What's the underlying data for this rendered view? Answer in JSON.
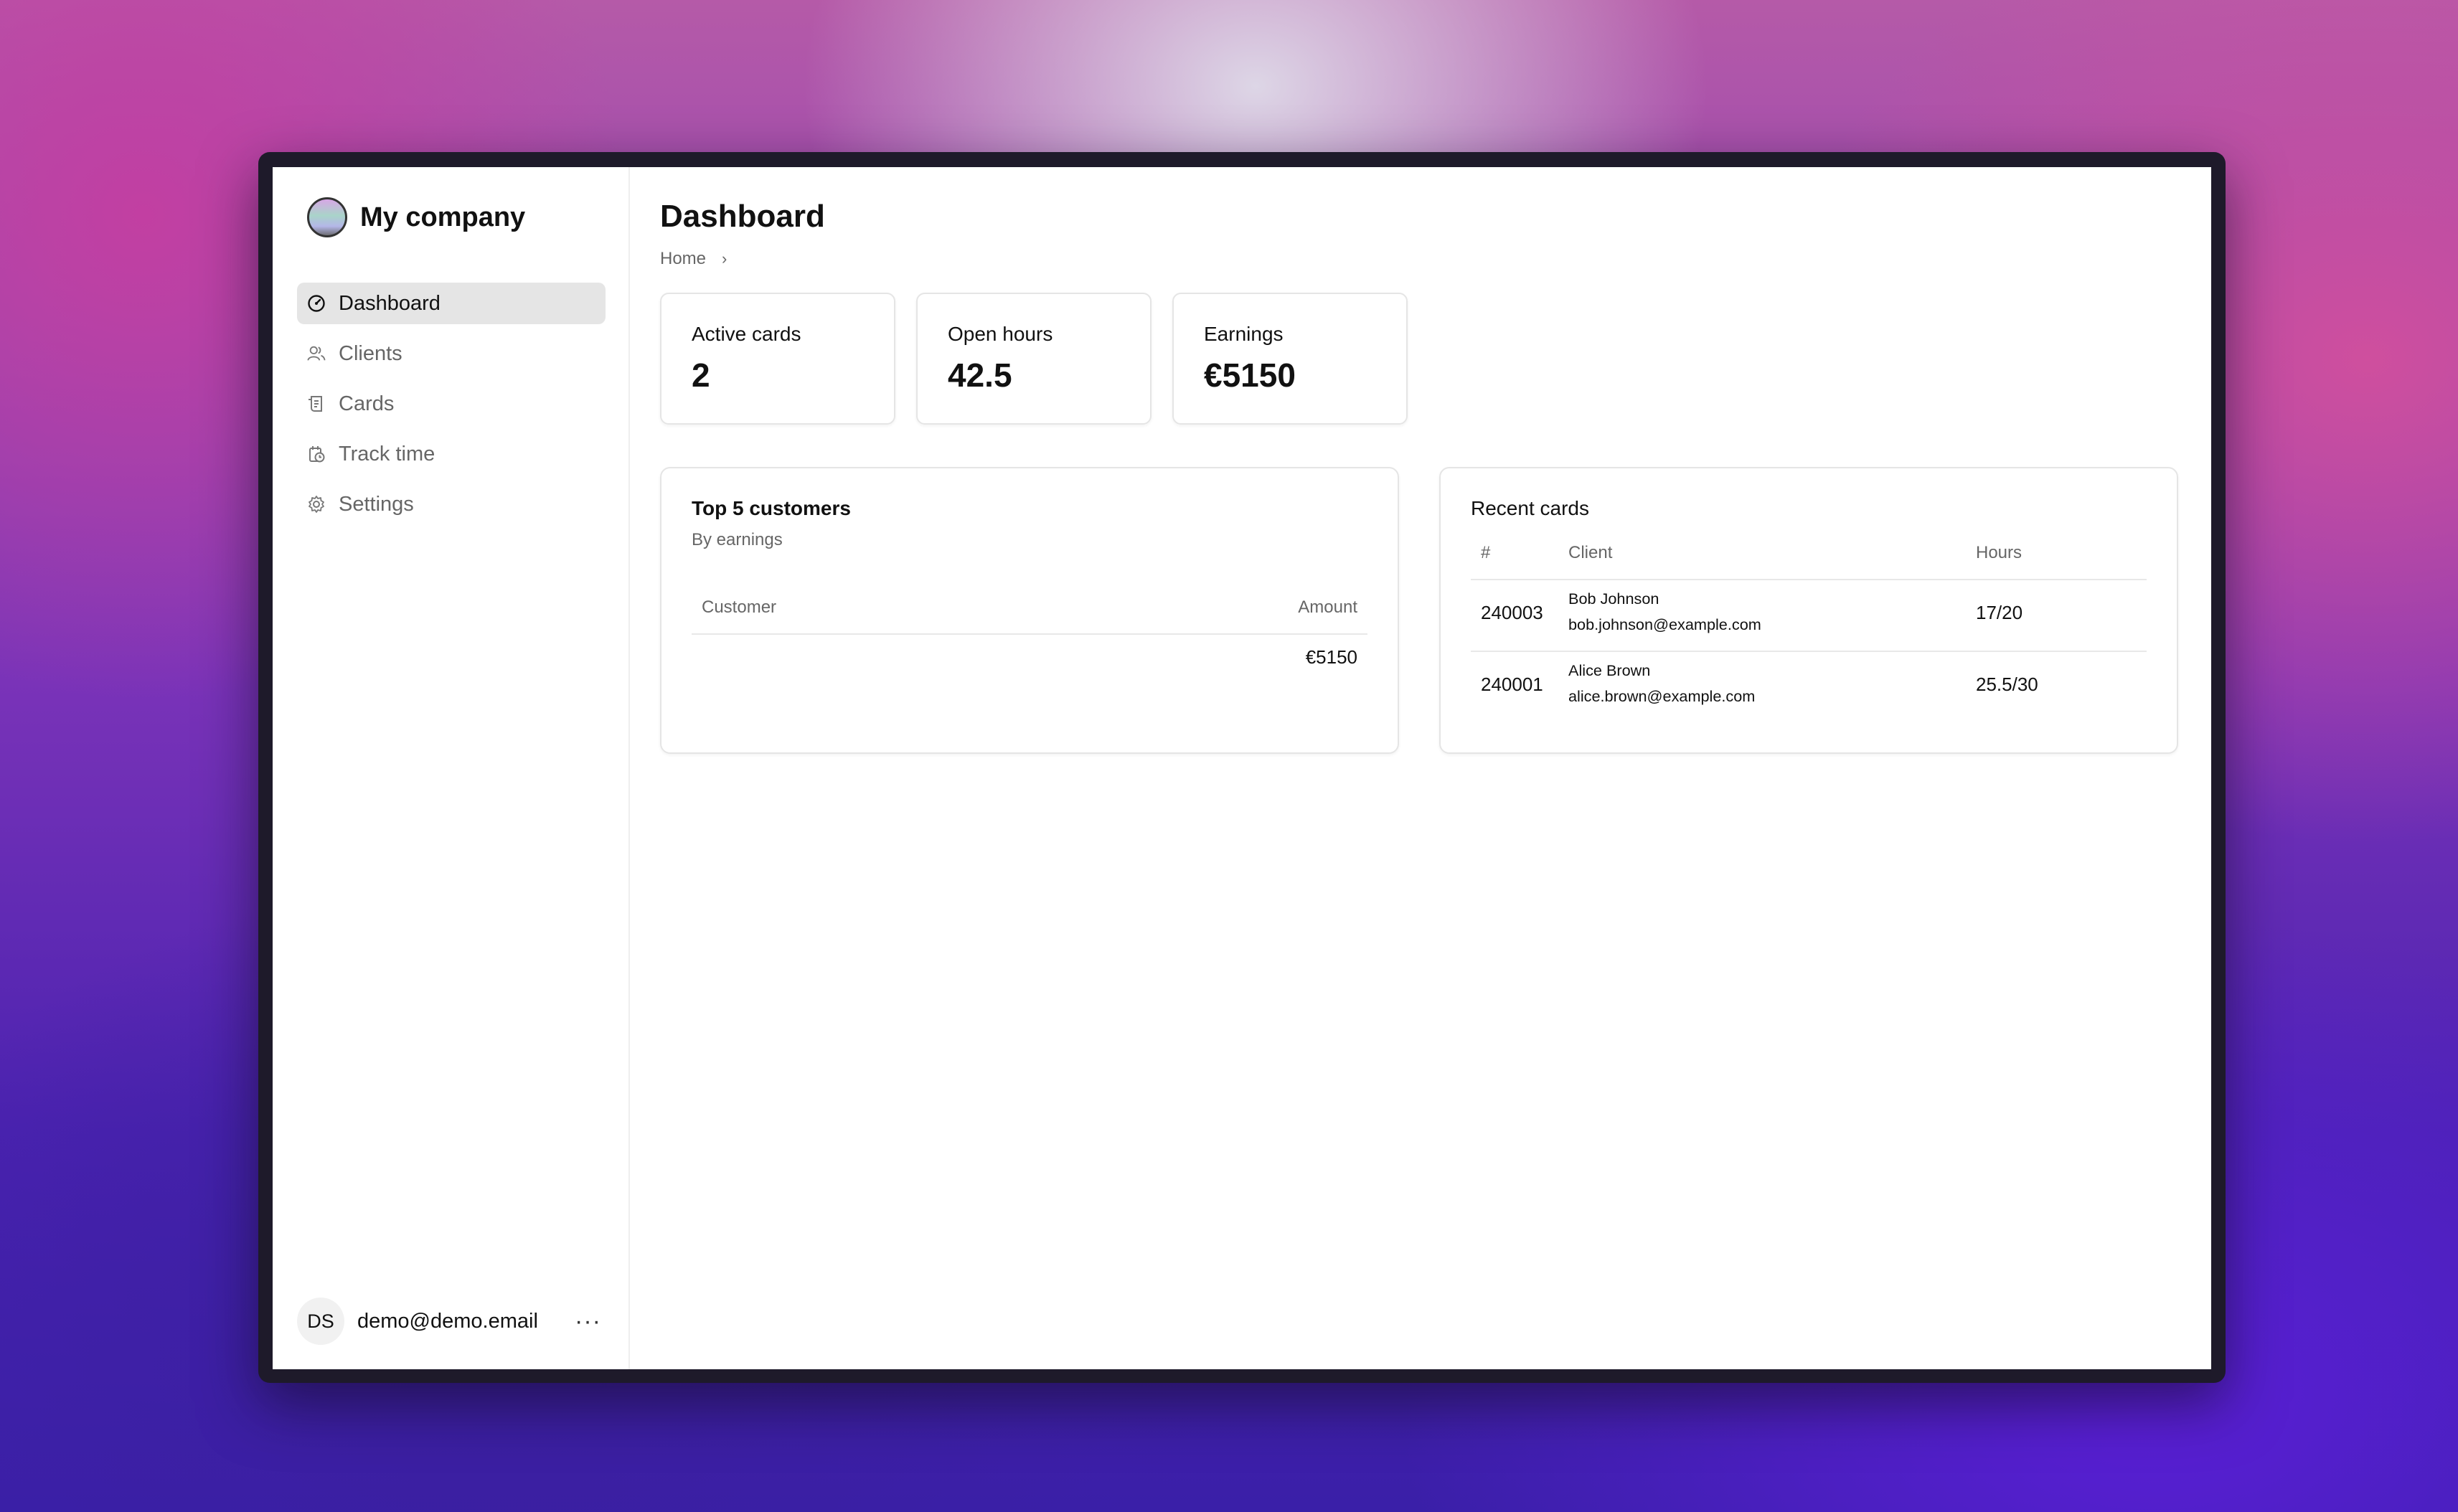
{
  "sidebar": {
    "company": "My company",
    "nav": [
      {
        "label": "Dashboard",
        "icon": "gauge-icon",
        "active": true
      },
      {
        "label": "Clients",
        "icon": "users-icon",
        "active": false
      },
      {
        "label": "Cards",
        "icon": "receipt-icon",
        "active": false
      },
      {
        "label": "Track time",
        "icon": "clock-icon",
        "active": false
      },
      {
        "label": "Settings",
        "icon": "gear-icon",
        "active": false
      }
    ],
    "user": {
      "initials": "DS",
      "email": "demo@demo.email",
      "menu": "···"
    }
  },
  "main": {
    "title": "Dashboard",
    "breadcrumb": {
      "home": "Home",
      "separator": "›"
    },
    "stats": [
      {
        "label": "Active cards",
        "value": "2"
      },
      {
        "label": "Open hours",
        "value": "42.5"
      },
      {
        "label": "Earnings",
        "value": "€5150"
      }
    ],
    "top_customers": {
      "title": "Top 5 customers",
      "subtitle": "By earnings",
      "columns": [
        "Customer",
        "Amount"
      ],
      "rows": [
        {
          "customer": "",
          "amount": "€5150"
        }
      ]
    },
    "recent_cards": {
      "title": "Recent cards",
      "columns": [
        "#",
        "Client",
        "Hours"
      ],
      "rows": [
        {
          "number": "240003",
          "client": "Bob Johnson",
          "email": "bob.johnson@example.com",
          "hours": "17/20"
        },
        {
          "number": "240001",
          "client": "Alice Brown",
          "email": "alice.brown@example.com",
          "hours": "25.5/30"
        }
      ]
    }
  }
}
